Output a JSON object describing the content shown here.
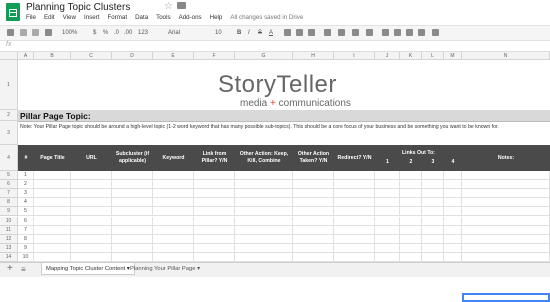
{
  "title_bar": {
    "doc_title": "Planning Topic Clusters",
    "menu": [
      "File",
      "Edit",
      "View",
      "Insert",
      "Format",
      "Data",
      "Tools",
      "Add-ons",
      "Help"
    ],
    "save_status": "All changes saved in Drive"
  },
  "toolbar": {
    "zoom": "100%",
    "currency": "$",
    "percent": "%",
    "decimals_less": ".0",
    "decimals_more": ".00",
    "number_format": "123",
    "font": "Arial",
    "font_size": "10",
    "bold": "B",
    "italic": "I",
    "strike": "S",
    "text_color": "A"
  },
  "formula_bar": {
    "fx": "fx"
  },
  "columns": [
    "A",
    "B",
    "C",
    "D",
    "E",
    "F",
    "G",
    "H",
    "I",
    "J",
    "K",
    "L",
    "M",
    "N"
  ],
  "sheet": {
    "logo_main": "StoryTeller",
    "logo_sub_left": "media",
    "logo_plus": "+",
    "logo_sub_right": "communications",
    "pillar_label": "Pillar Page Topic:",
    "note": "Note: Your Pillar Page topic should be around a high-level topic (1-2 word keyword that has many possible sub-topics). This should be a core focus of your business and be something you want to be known for.",
    "headers": {
      "num": "#",
      "page_title": "Page Title",
      "url": "URL",
      "subcluster": "Subcluster (if applicable)",
      "keyword": "Keyword",
      "link_from_pillar": "Link from Pillar? Y/N",
      "other_action": "Other Action: Keep, Kill, Combine",
      "other_action_taken": "Other Action Taken? Y/N",
      "redirect": "Redirect? Y/N",
      "links_out_to": "Links Out To:",
      "l1": "1",
      "l2": "2",
      "l3": "3",
      "l4": "4",
      "notes": "Notes:"
    },
    "row_numbers": [
      "1",
      "2",
      "3",
      "4",
      "5",
      "6",
      "7",
      "8",
      "9",
      "10"
    ],
    "grid_row_numbers": [
      "1",
      "2",
      "3",
      "4",
      "5",
      "6",
      "7",
      "8",
      "9",
      "10",
      "11",
      "12",
      "13",
      "14",
      "15",
      "16"
    ]
  },
  "tabs": {
    "active": "Mapping Topic Cluster Content",
    "other": "Planning Your Pillar Page"
  },
  "colors": {
    "brand_green": "#0f9d58",
    "header_dark": "#4a4a4a",
    "band_gray": "#d9d9d9",
    "accent_red": "#e0442d",
    "selection_blue": "#4285f4"
  }
}
